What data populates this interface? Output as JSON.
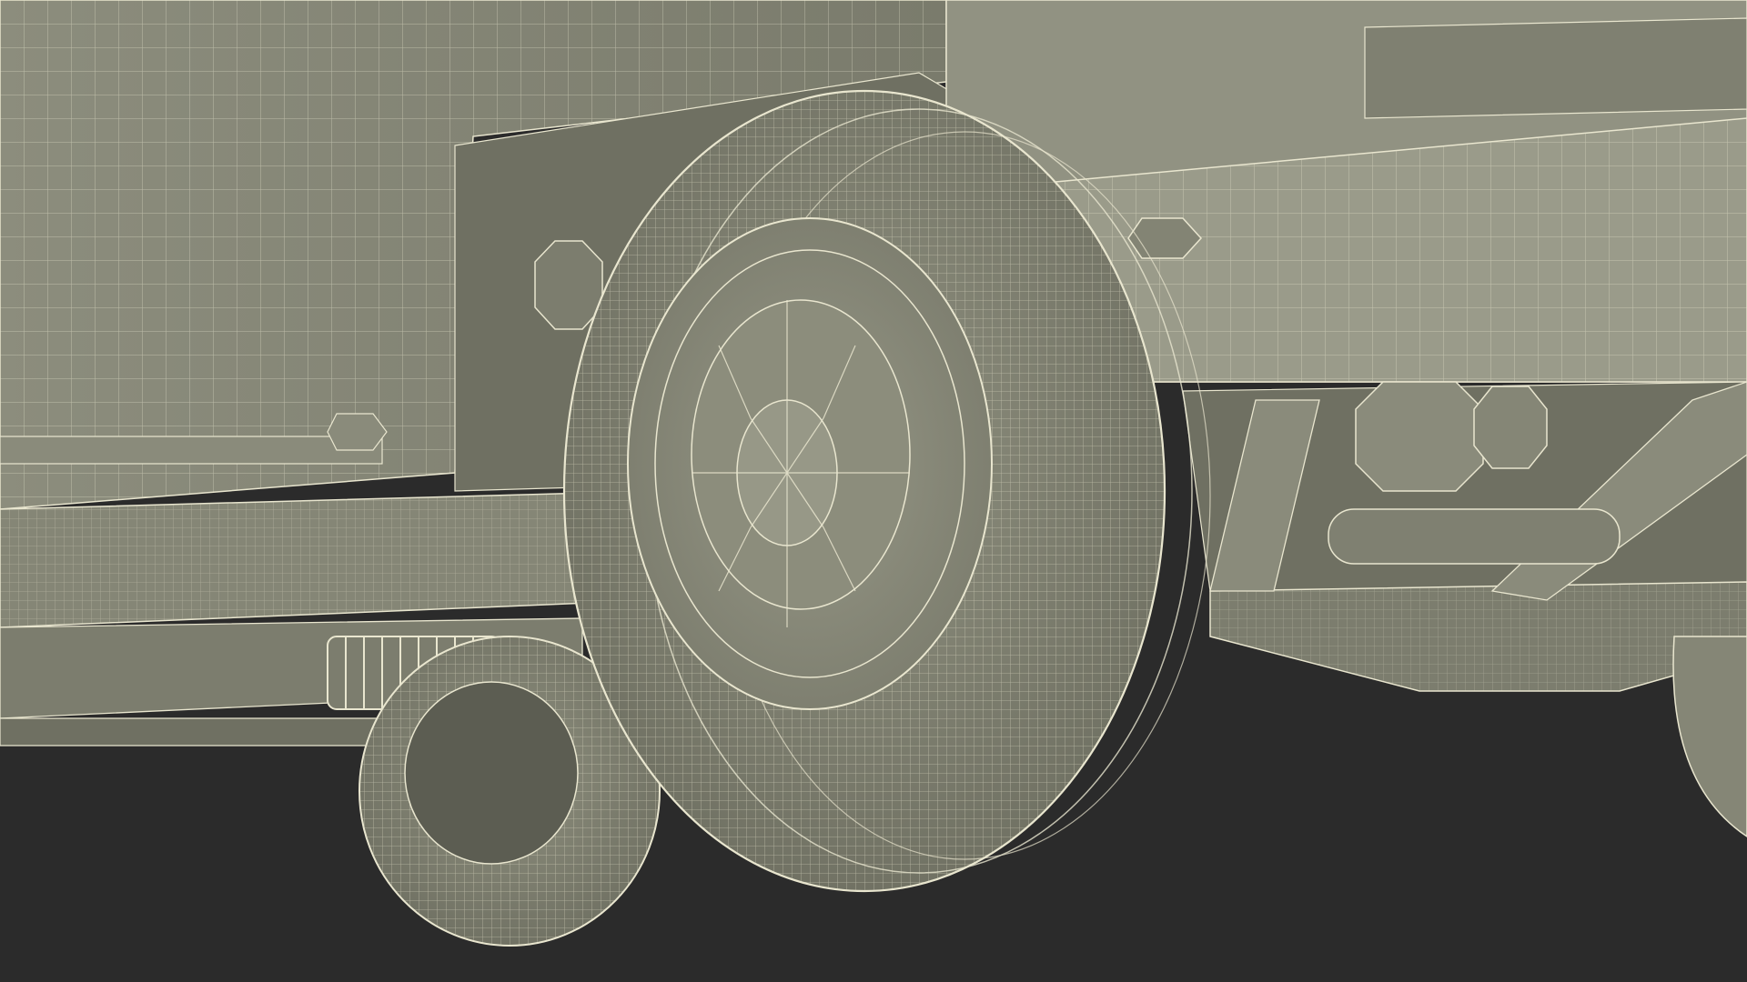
{
  "scene": {
    "subject": "wireframe-truck-underside",
    "colors": {
      "background": "#2b2b2b",
      "surface": "#8d8e7e",
      "surface_light": "#9a9b8a",
      "surface_dark": "#6f7062",
      "surface_shadow": "#5c5d52",
      "wire": "#e9e6cf"
    }
  }
}
